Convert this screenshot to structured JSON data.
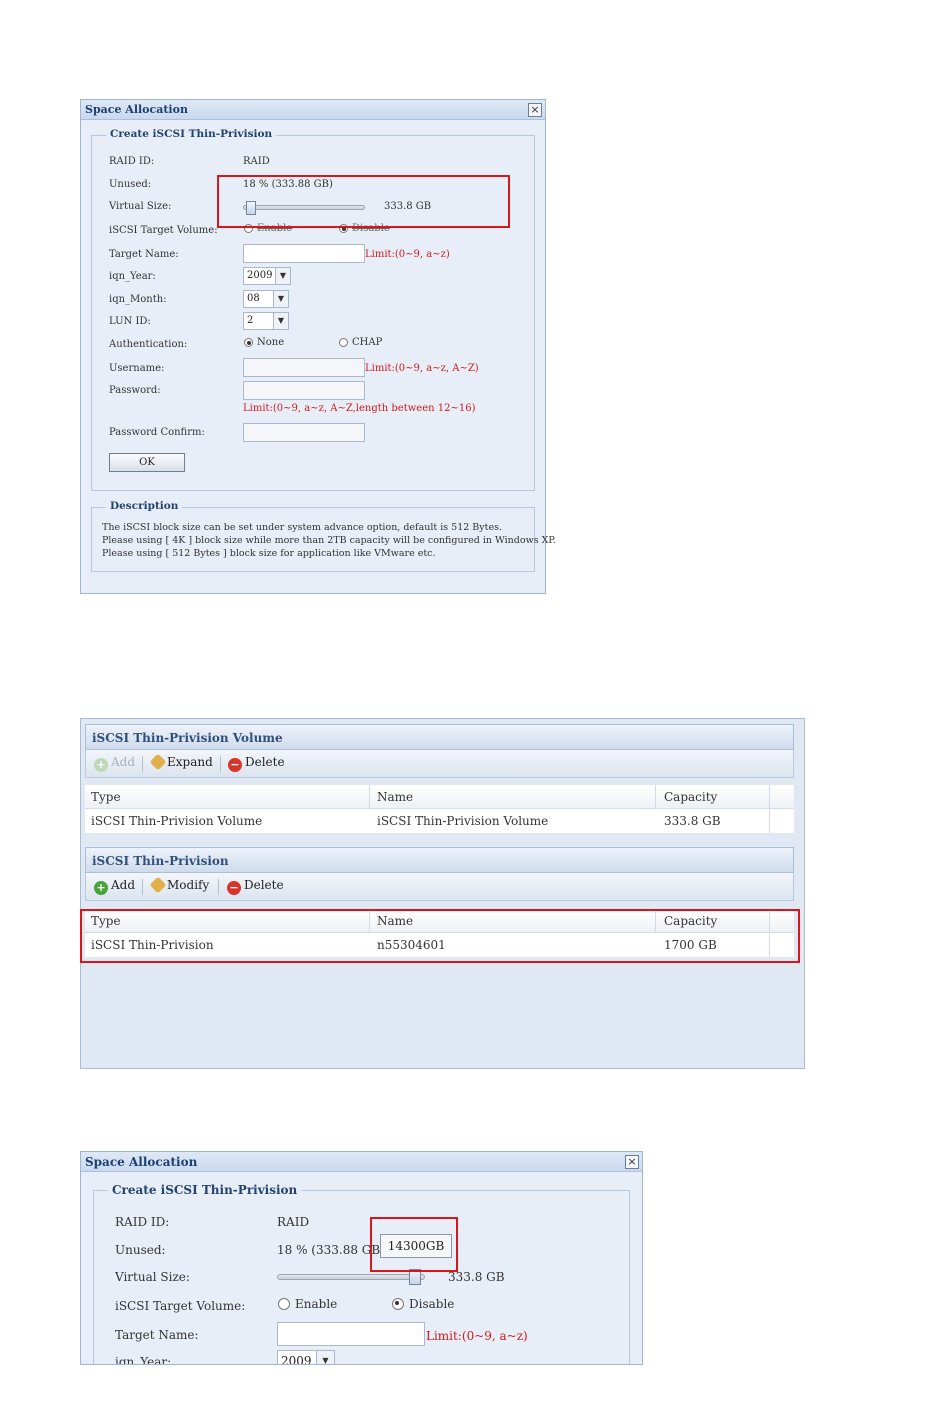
{
  "dialog1": {
    "title": "Space Allocation",
    "close": "×",
    "legend": "Create iSCSI Thin-Privision",
    "labels": {
      "raid_id": "RAID ID:",
      "unused": "Unused:",
      "virtual_size": "Virtual Size:",
      "target_volume": "iSCSI Target Volume:",
      "target_name": "Target Name:",
      "iqn_year": "iqn_Year:",
      "iqn_month": "iqn_Month:",
      "lun_id": "LUN ID:",
      "authentication": "Authentication:",
      "username": "Username:",
      "password": "Password:",
      "password_confirm": "Password Confirm:"
    },
    "values": {
      "raid_id": "RAID",
      "unused": "18 % (333.88 GB)",
      "virtual_size": "333.8 GB",
      "virtual_size_fraction": 0.03,
      "enable": "Enable",
      "disable": "Disable",
      "target_name_limit": "Limit:(0~9, a~z)",
      "iqn_year": "2009",
      "iqn_month": "08",
      "lun_id": "2",
      "auth_none": "None",
      "auth_chap": "CHAP",
      "username_limit": "Limit:(0~9, a~z, A~Z)",
      "password_limit": "Limit:(0~9, a~z, A~Z,length between 12~16)"
    },
    "ok": "OK",
    "desc_legend": "Description",
    "desc_lines": [
      "The iSCSI block size can be set under system advance option, default is 512 Bytes.",
      "Please using [ 4K ] block size while more than 2TB capacity will be configured in Windows XP.",
      "Please using [ 512 Bytes ] block size for application like VMware etc."
    ]
  },
  "panel": {
    "volume_header": "iSCSI Thin-Privision Volume",
    "toolbar1": {
      "add": "Add",
      "expand": "Expand",
      "delete": "Delete"
    },
    "columns": [
      "Type",
      "Name",
      "Capacity"
    ],
    "volume_row": [
      "iSCSI Thin-Privision Volume",
      "iSCSI Thin-Privision Volume",
      "333.8 GB"
    ],
    "tp_header": "iSCSI Thin-Privision",
    "toolbar2": {
      "add": "Add",
      "modify": "Modify",
      "delete": "Delete"
    },
    "tp_row": [
      "iSCSI Thin-Privision",
      "n55304601",
      "1700 GB"
    ]
  },
  "dialog2": {
    "title": "Space Allocation",
    "close": "×",
    "legend": "Create iSCSI Thin-Privision",
    "labels": {
      "raid_id": "RAID ID:",
      "unused": "Unused:",
      "virtual_size": "Virtual Size:",
      "target_volume": "iSCSI Target Volume:",
      "target_name": "Target Name:",
      "iqn_year": "iqn_Year:"
    },
    "values": {
      "raid_id": "RAID",
      "unused": "18 % (333.88 GB",
      "tooltip": "14300GB",
      "virtual_size": "333.8 GB",
      "virtual_size_fraction": 0.97,
      "enable": "Enable",
      "disable": "Disable",
      "target_name_limit": "Limit:(0~9, a~z)",
      "iqn_year": "2009"
    }
  }
}
